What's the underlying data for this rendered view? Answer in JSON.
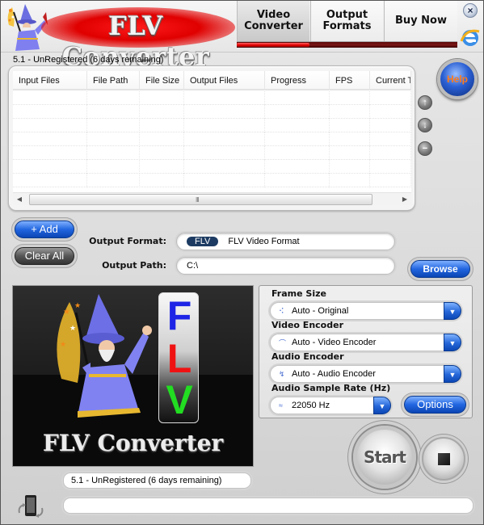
{
  "app": {
    "logo_text": "FLV Converter",
    "version_status": "5.1 - UnRegistered (6 days remaining)"
  },
  "nav": {
    "tabs": [
      {
        "label": "Video\nConverter",
        "active": true
      },
      {
        "label": "Output\nFormats",
        "active": false
      },
      {
        "label": "Buy Now",
        "active": false
      }
    ],
    "close_icon": "×",
    "browser_icon": "ie-icon",
    "accent_color": "#e00000"
  },
  "file_table": {
    "columns": [
      "Input Files",
      "File Path",
      "File Size",
      "Output Files",
      "Progress",
      "FPS",
      "Current T"
    ],
    "rows": [],
    "scroll_left": "◀",
    "scroll_right": "▶",
    "scroll_grip": "III"
  },
  "side_buttons": {
    "help_label": "Help",
    "move_up": "↑",
    "move_down": "↓",
    "remove": "−"
  },
  "actions": {
    "add_label": "+ Add",
    "clear_label": "Clear All",
    "browse_label": "Browse",
    "options_label": "Options",
    "start_label": "Start"
  },
  "output": {
    "format_label": "Output Format:",
    "format_badge": "FLV",
    "format_value": "FLV Video Format",
    "path_label": "Output Path:",
    "path_value": "C:\\"
  },
  "preview": {
    "title": "FLV Converter",
    "letters": [
      "F",
      "L",
      "V"
    ]
  },
  "settings": {
    "frame_size_label": "Frame Size",
    "frame_size_value": "Auto - Original",
    "frame_size_icon": "⠪",
    "video_encoder_label": "Video Encoder",
    "video_encoder_value": "Auto  -  Video Encoder",
    "video_encoder_icon": "⌒",
    "audio_encoder_label": "Audio Encoder",
    "audio_encoder_value": "Auto  -  Audio Encoder",
    "audio_encoder_icon": "↯",
    "sample_rate_label": "Audio Sample Rate (Hz)",
    "sample_rate_value": "22050 Hz",
    "sample_rate_icon": "≈",
    "dropdown_arrow": "▼"
  },
  "status": {
    "text": "5.1 - UnRegistered (6 days remaining)",
    "progress_percent": 0
  }
}
